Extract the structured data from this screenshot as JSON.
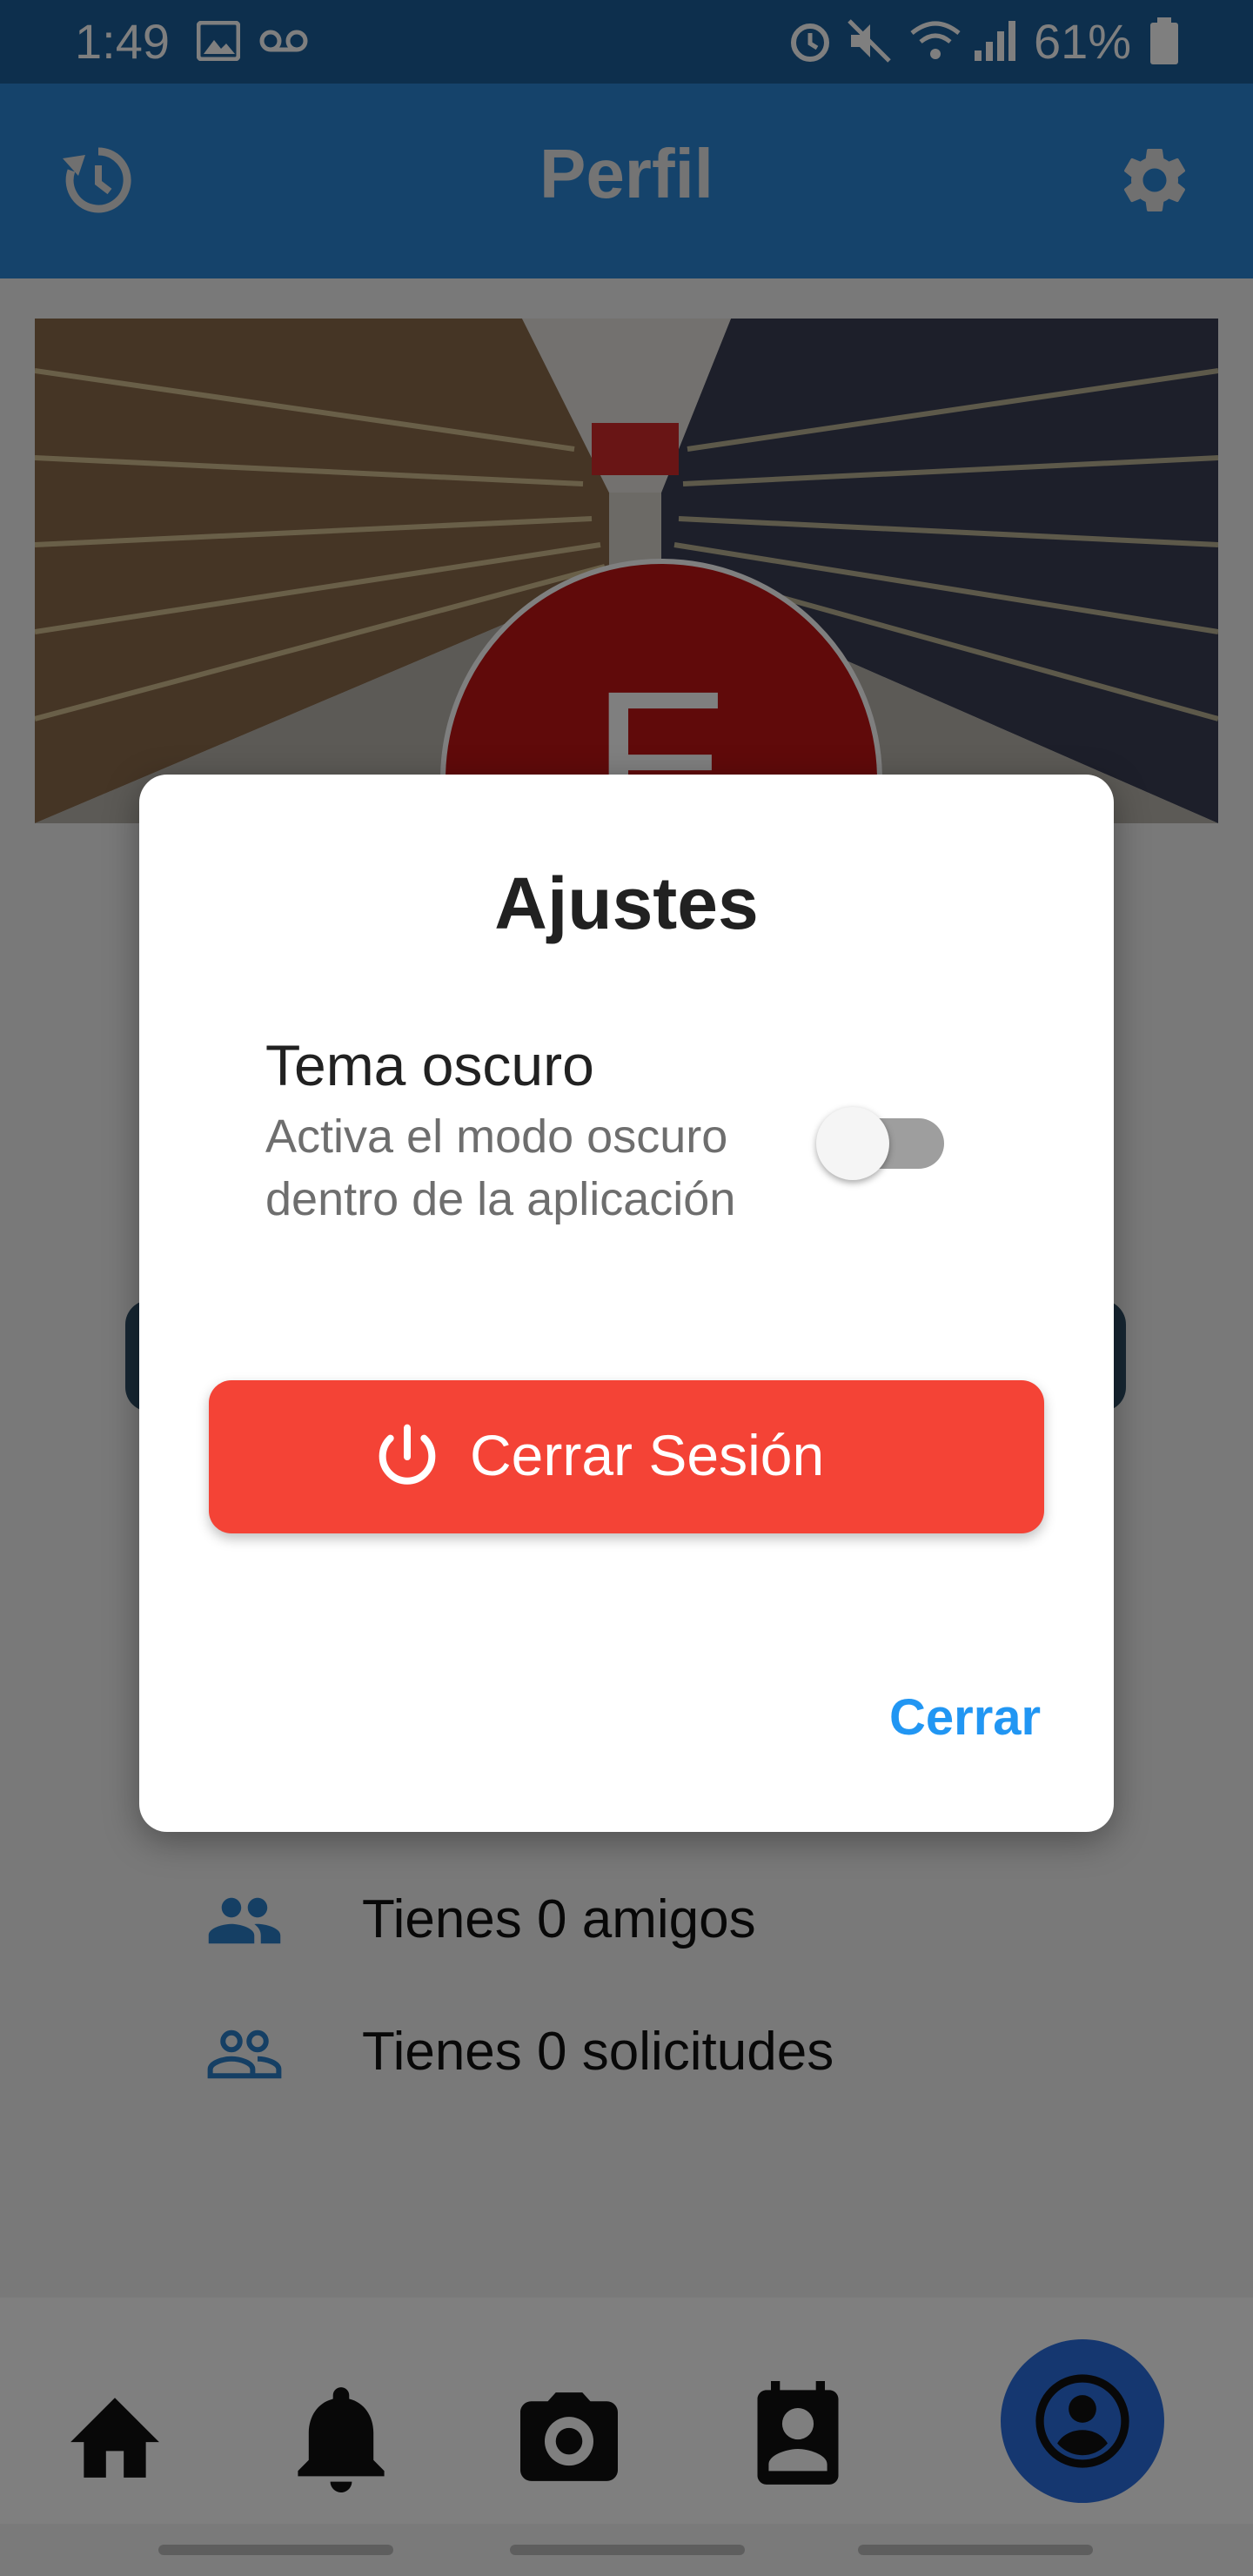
{
  "status_bar": {
    "time": "1:49",
    "battery": "61%",
    "icons": [
      "image-icon",
      "voicemail-icon",
      "alarm-icon",
      "mute-icon",
      "wifi-icon",
      "signal-icon",
      "battery-icon"
    ]
  },
  "app_bar": {
    "title": "Perfil",
    "left_icon": "history-icon",
    "right_icon": "settings-gear-icon"
  },
  "profile": {
    "avatar_letter": "E"
  },
  "stats": [
    {
      "icon": "friends-icon",
      "text": "Tienes 0 amigos"
    },
    {
      "icon": "requests-icon",
      "text": "Tienes 0 solicitudes"
    }
  ],
  "bottom_nav": {
    "items": [
      "home-icon",
      "bell-icon",
      "camera-icon",
      "contact-icon",
      "profile-icon"
    ]
  },
  "dialog": {
    "title": "Ajustes",
    "setting": {
      "title": "Tema oscuro",
      "description": "Activa el modo oscuro dentro de la aplicación",
      "enabled": false
    },
    "logout_label": "Cerrar Sesión",
    "close_label": "Cerrar"
  },
  "colors": {
    "app_bar": "#2b86d6",
    "logout": "#f44336",
    "close_link": "#2196f3",
    "avatar": "#c01414"
  }
}
